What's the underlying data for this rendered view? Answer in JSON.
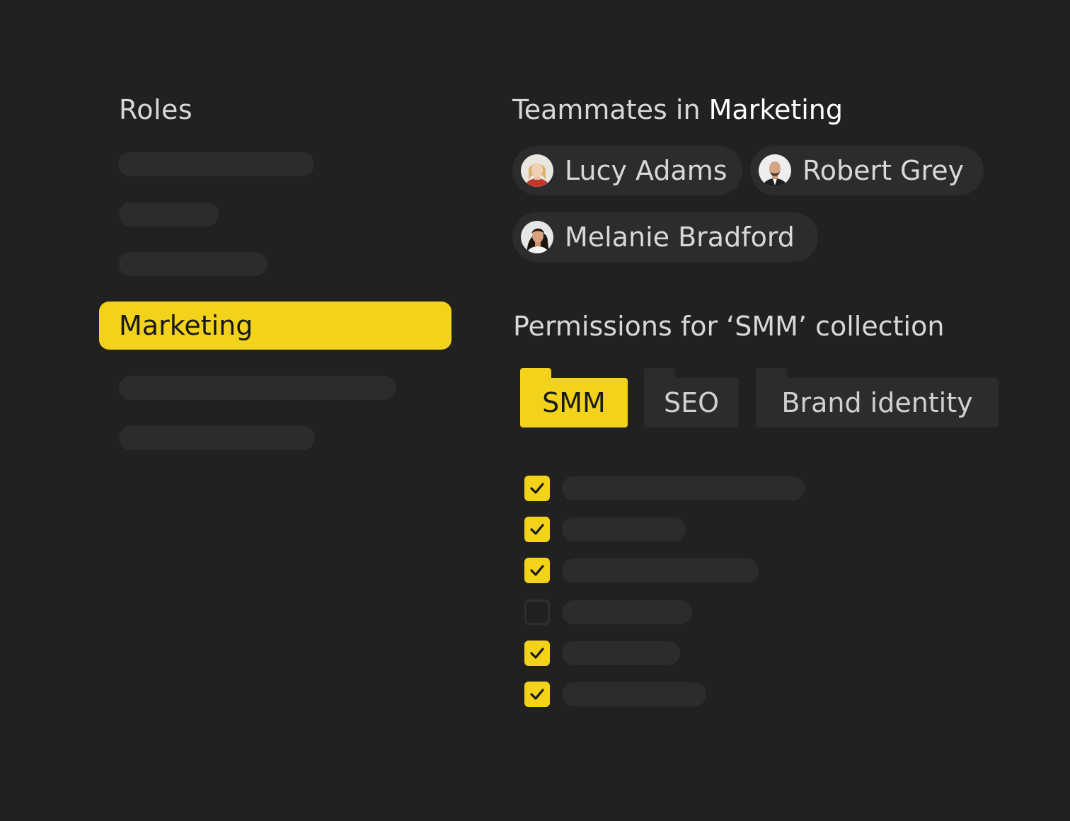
{
  "roles": {
    "heading": "Roles",
    "selected_label": "Marketing"
  },
  "team": {
    "heading_prefix": "Teammates in ",
    "heading_role": "Marketing",
    "members": [
      {
        "name": "Lucy Adams",
        "avatar_icon": "avatar-photo"
      },
      {
        "name": "Robert Grey",
        "avatar_icon": "avatar-photo"
      },
      {
        "name": "Melanie Bradford",
        "avatar_icon": "avatar-photo"
      }
    ]
  },
  "permissions": {
    "heading": "Permissions for ‘SMM’ collection",
    "tabs": [
      {
        "label": "SMM",
        "active": true
      },
      {
        "label": "SEO",
        "active": false
      },
      {
        "label": "Brand identity",
        "active": false
      }
    ],
    "items": [
      {
        "checked": true
      },
      {
        "checked": true
      },
      {
        "checked": true
      },
      {
        "checked": false
      },
      {
        "checked": true
      },
      {
        "checked": true
      }
    ]
  },
  "colors": {
    "background": "#212121",
    "accent": "#f2d21a",
    "skeleton": "#2c2c2c",
    "text": "#d8d8d8"
  }
}
